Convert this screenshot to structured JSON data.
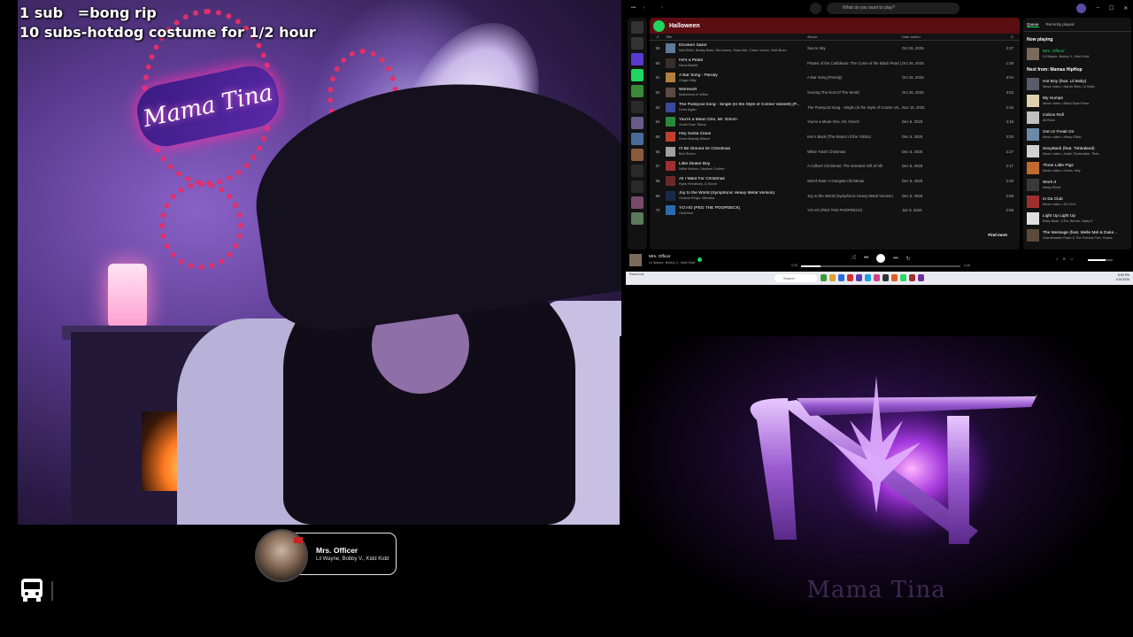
{
  "overlay": {
    "goal_line_1": "1 sub   =bong rip",
    "goal_line_2": "10 subs-hotdog costume for 1/2 hour"
  },
  "webcam": {
    "neon_sign_text": "Mama Tina"
  },
  "now_playing_widget": {
    "title": "Mrs. Officer",
    "artists": "Lil Wayne, Bobby V., Kidd Kidd"
  },
  "spotify": {
    "search_placeholder": "What do you want to play?",
    "playlist_name": "Halloween",
    "columns": {
      "num": "#",
      "title": "Title",
      "album": "Album",
      "date": "Date added",
      "duration": ""
    },
    "tracks": [
      {
        "num": "59",
        "title": "Drunken Sailor",
        "artist": "MALINDA, Bobby Bass, Mia Asano, Ryan Alls, Cohen Vance, Seth Buzz...",
        "album": "Sea to Sky",
        "date": "Oct 26, 2025",
        "duration": "2:27",
        "thumb": "#5d7a9a"
      },
      {
        "num": "60",
        "title": "He's a Pirate",
        "artist": "Klaus Badelt",
        "album": "Pirates of the Caribbean: The Curse of the Black Pearl (...",
        "date": "Oct 26, 2025",
        "duration": "1:30",
        "thumb": "#3a2e28"
      },
      {
        "num": "61",
        "title": "A Bar Song - Parody",
        "artist": "Ginger Billy",
        "album": "A Bar Song (Parody)",
        "date": "Oct 26, 2025",
        "duration": "3:04",
        "thumb": "#b08040"
      },
      {
        "num": "62",
        "title": "Werewolf",
        "artist": "Motionless In White",
        "album": "Scoring The End Of The World",
        "date": "Oct 26, 2025",
        "duration": "3:52",
        "thumb": "#5a4a40"
      },
      {
        "num": "63",
        "title": "The Pussycat Song - Single (In the Style of Connie Vannett) [P...",
        "artist": "Done Again",
        "album": "The Pussycat Song - Single (In the Style of Connie Va...",
        "date": "Nov 15, 2025",
        "duration": "2:46",
        "thumb": "#3a4a9a"
      },
      {
        "num": "64",
        "title": "You're a Mean One, Mr. Grinch",
        "artist": "Small Town Titans",
        "album": "You're a Mean One, Mr. Grinch",
        "date": "Dec 5, 2025",
        "duration": "4:18",
        "thumb": "#2a8a3a"
      },
      {
        "num": "65",
        "title": "Hey Santa Claus",
        "artist": "Kevin Brandy Wilson",
        "album": "Kev's Back (The Return of the Yobbo)",
        "date": "Dec 5, 2025",
        "duration": "3:03",
        "thumb": "#c04030"
      },
      {
        "num": "66",
        "title": "I'll Be Stoned for Christmas",
        "artist": "Bob Rivers",
        "album": "White Trash Christmas",
        "date": "Dec 5, 2025",
        "duration": "2:27",
        "thumb": "#a0a0a0"
      },
      {
        "num": "67",
        "title": "Little Dealer Boy",
        "artist": "Willie Nelson, Stephen Colbert",
        "album": "A Colbert Christmas: The Greatest Gift of All!",
        "date": "Dec 5, 2025",
        "duration": "2:17",
        "thumb": "#a03030"
      },
      {
        "num": "68",
        "title": "All I Want For Christmas",
        "artist": "Ryan Hendricks, D-Stone",
        "album": "Weird Rant: A Gangsta Christmas",
        "date": "Dec 5, 2025",
        "duration": "2:20",
        "thumb": "#6a2a2a"
      },
      {
        "num": "69",
        "title": "Joy to the World (Symphonic Heavy Metal Version)",
        "artist": "Octavia Reign, Mendisa",
        "album": "Joy to the World (Symphonic Heavy Metal Version)",
        "date": "Dec 5, 2025",
        "duration": "2:56",
        "thumb": "#1a2a4a"
      },
      {
        "num": "70",
        "title": "YO HO (PEG THE POOPDECK)",
        "artist": "OneDeen",
        "album": "YO HO (PEG THE POOPDECK)",
        "date": "Jan 8, 2026",
        "duration": "2:56",
        "thumb": "#2a6ab0"
      }
    ],
    "find_more": "Find more",
    "queue": {
      "tab_queue": "Queue",
      "tab_recent": "Recently played",
      "now_playing_header": "Now playing",
      "now_playing": {
        "title": "Mrs. Officer",
        "artist": "Lil Wayne, Bobby V., Kidd Kidd",
        "thumb": "#7a6a5c"
      },
      "next_header": "Next from: Mamas HipHop",
      "items": [
        {
          "title": "Hot Boy (feat. Lil Baby)",
          "artist": "Music video • Nardo Wick, Lil Baby",
          "thumb": "#5a5a6a"
        },
        {
          "title": "My Humps",
          "artist": "Music video • Black Eyed Peas",
          "thumb": "#e0d0b0"
        },
        {
          "title": "Icebox Roll",
          "artist": "All Boss",
          "thumb": "#c0c0c0"
        },
        {
          "title": "Get Ur Freak On",
          "artist": "Music video • Missy Elliott",
          "thumb": "#6a8aaa"
        },
        {
          "title": "SexyBack (feat. Timbaland)",
          "artist": "Music video • Justin Timberlake, Timb...",
          "thumb": "#d0d0d0"
        },
        {
          "title": "Three Little Pigs",
          "artist": "Music video • Green Jelly",
          "thumb": "#c06a30"
        },
        {
          "title": "Work It",
          "artist": "Missy Elliott",
          "thumb": "#3a3a3a"
        },
        {
          "title": "In Da Club",
          "artist": "Music video • 50 Cent",
          "thumb": "#a03030"
        },
        {
          "title": "Light Up Light Up",
          "artist": "Baby Bash, Z-Ro, Berner, Baby E",
          "thumb": "#e0e0e0"
        },
        {
          "title": "The Message (feat. Melle Mel & Duke...",
          "artist": "Grandmaster Flash & The Furious Five, Grand...",
          "thumb": "#5a4a3a"
        }
      ]
    },
    "player": {
      "title": "Mrs. Officer",
      "artists": "Lil Wayne, Bobby V., Kidd Kidd",
      "time_current": "0:35",
      "time_total": "4:46",
      "progress": 0.12,
      "volume": 0.7
    }
  },
  "taskbar": {
    "toast": "Fuck a Lot",
    "search_placeholder": "Search",
    "clock_time": "8:55 PM",
    "clock_date": "1/10/2026",
    "app_colors": [
      "#3a9a3a",
      "#e0a030",
      "#2a6ae0",
      "#d03030",
      "#5a3ab0",
      "#20a0e0",
      "#d04090",
      "#333333",
      "#e06020",
      "#2ad760",
      "#a03030",
      "#7030a0"
    ]
  },
  "logo": {
    "text": "Mama Tina"
  }
}
